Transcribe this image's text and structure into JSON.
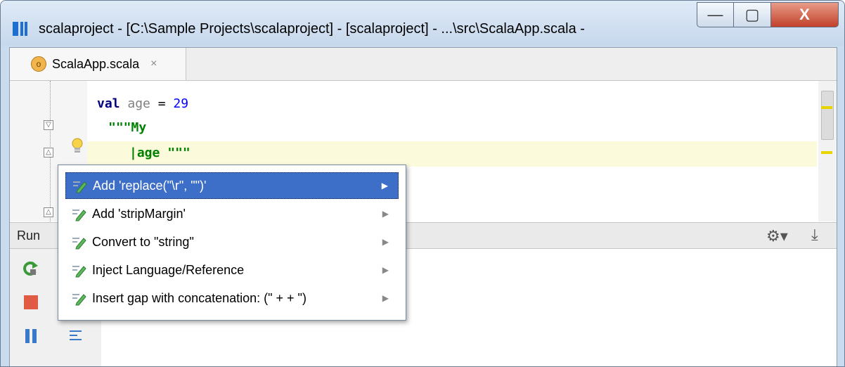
{
  "window": {
    "title": "scalaproject - [C:\\Sample Projects\\scalaproject] - [scalaproject] - ...\\src\\ScalaApp.scala -",
    "minimize_glyph": "—",
    "maximize_glyph": "▢",
    "close_glyph": "X"
  },
  "tab": {
    "icon_glyph": "o",
    "label": "ScalaApp.scala",
    "close": "×"
  },
  "code": {
    "line1": {
      "keyword": "val",
      "ident": "age",
      "op": " = ",
      "number": "29"
    },
    "line2": {
      "string": "\"\"\"My"
    },
    "line3": {
      "string_pipe": "|age",
      "string_close": " \"\"\""
    }
  },
  "fold_glyphs": [
    "▽",
    "△",
    "△"
  ],
  "run_panel": {
    "label": "Run",
    "gear_icon": "gear-icon",
    "download_icon": "download-icon"
  },
  "popup": {
    "items": [
      {
        "label": "Add 'replace(\"\\r\", \"\")'",
        "selected": true
      },
      {
        "label": "Add 'stripMargin'",
        "selected": false
      },
      {
        "label": "Convert to \"string\"",
        "selected": false
      },
      {
        "label": "Inject Language/Reference",
        "selected": false
      },
      {
        "label": "Insert gap with concatenation: (\" +  + \")",
        "selected": false
      }
    ],
    "arrow": "▶"
  },
  "colors": {
    "selection": "#3d6fc8",
    "highlight_line": "#fbfbdc",
    "keyword": "#000080",
    "string": "#008000",
    "number": "#0000ff"
  }
}
